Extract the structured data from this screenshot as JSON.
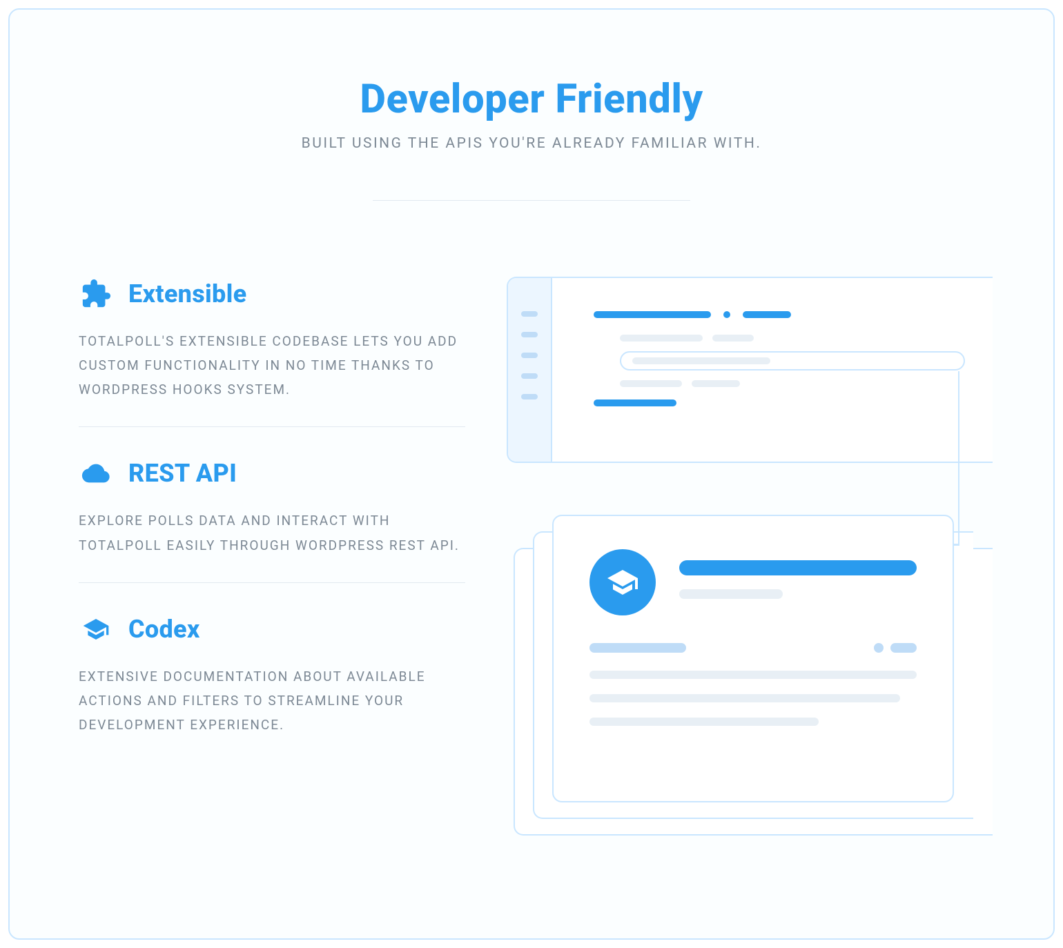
{
  "header": {
    "title": "Developer Friendly",
    "subtitle": "BUILT USING THE APIS YOU'RE ALREADY FAMILIAR WITH."
  },
  "features": [
    {
      "icon": "puzzle-icon",
      "title": "Extensible",
      "body": "TOTALPOLL'S EXTENSIBLE CODEBASE LETS YOU ADD CUSTOM FUNCTIONALITY IN NO TIME THANKS TO WORDPRESS HOOKS SYSTEM."
    },
    {
      "icon": "cloud-icon",
      "title": "REST API",
      "body": "EXPLORE POLLS DATA AND INTERACT WITH TOTALPOLL EASILY THROUGH WORDPRESS REST API."
    },
    {
      "icon": "graduation-cap-icon",
      "title": "Codex",
      "body": "EXTENSIVE DOCUMENTATION ABOUT AVAILABLE ACTIONS AND FILTERS TO STREAMLINE YOUR DEVELOPMENT EXPERIENCE."
    }
  ],
  "colors": {
    "accent": "#2a9bee",
    "border": "#c9e6ff",
    "muted": "#7c8894"
  }
}
